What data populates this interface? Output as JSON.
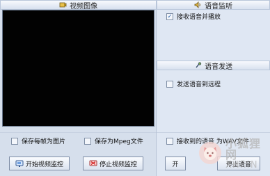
{
  "left": {
    "title": "视频图像",
    "save_image_label": "保存每帧为图片",
    "save_mpeg_label": "保存为Mpeg文件",
    "start_video_btn": "开始视频监控",
    "stop_video_btn": "停止视频监控"
  },
  "voice_monitor": {
    "title": "语音监听",
    "receive_play_label": "接收语音并播放",
    "receive_play_checked": true
  },
  "voice_send": {
    "title": "语音发送",
    "send_remote_label": "发送语音到远程"
  },
  "bottom_right": {
    "save_wav_label": "接收到的语音 为WAV文件",
    "start_btn": "开",
    "stop_btn": "停止语音"
  },
  "watermark": {
    "main": "小狐狸网",
    "sub": "XH...N"
  },
  "icons": {
    "video_header": "camera-icon",
    "voice_monitor_header": "speaker-icon",
    "voice_send_header": "microphone-icon",
    "start_video": "monitor-start-icon",
    "stop_video": "monitor-stop-icon"
  },
  "colors": {
    "video_bg": "#020202",
    "panel_bg": "#d6dfec",
    "check_color": "#0e4ea0"
  }
}
